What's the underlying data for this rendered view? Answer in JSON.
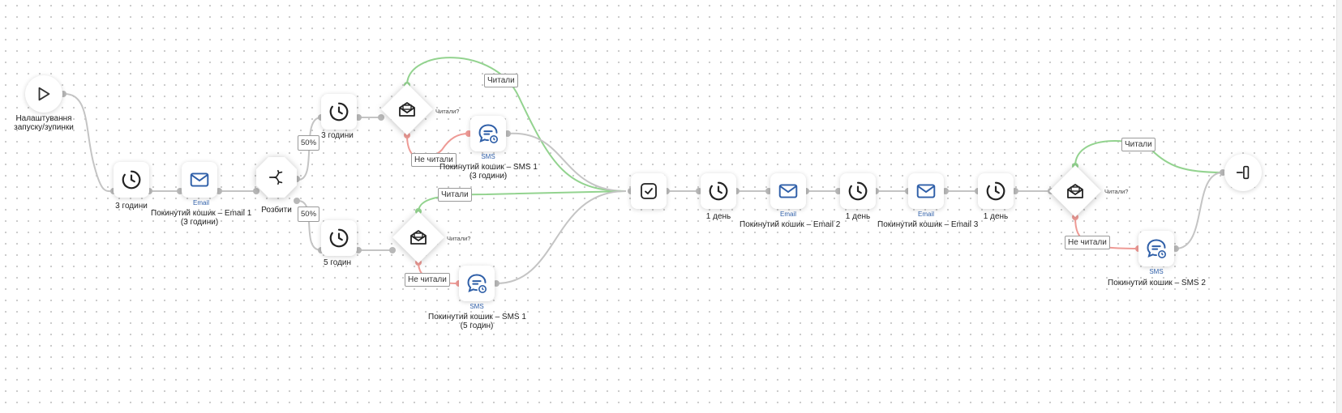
{
  "colors": {
    "edge": "#c4c4c4",
    "yes": "#93d38f",
    "no": "#ee9a95",
    "brand": "#2f5fa8"
  },
  "nodes": {
    "start": {
      "label_line1": "Налаштування",
      "label_line2": "запуску/зупинки",
      "icon": "play-icon"
    },
    "wait_1": {
      "label": "3 години",
      "icon": "clock-icon"
    },
    "email_1": {
      "sub": "Email",
      "label_line1": "Покинутий кошик – Email 1",
      "label_line2": "(3 години)",
      "icon": "mail-icon"
    },
    "split": {
      "label": "Розбити",
      "icon": "split-icon"
    },
    "wait_top": {
      "label": "3 години",
      "icon": "clock-icon"
    },
    "check_top": {
      "question": "Читали?",
      "icon": "mail-open-icon"
    },
    "sms_top": {
      "sub": "SMS",
      "label_line1": "Покинутий кошик – SMS 1",
      "label_line2": "(3 години)",
      "icon": "sms-icon"
    },
    "wait_bottom": {
      "label": "5 годин",
      "icon": "clock-icon"
    },
    "check_bottom": {
      "question": "Читали?",
      "icon": "mail-open-icon"
    },
    "sms_bottom": {
      "sub": "SMS",
      "label_line1": "Покинутий кошик – SMS 1",
      "label_line2": "(5 годин)",
      "icon": "sms-icon"
    },
    "merge": {
      "icon": "check-icon"
    },
    "wait_2": {
      "label": "1 день",
      "icon": "clock-icon"
    },
    "email_2": {
      "sub": "Email",
      "label": "Покинутий кошик – Email 2",
      "icon": "mail-icon"
    },
    "wait_3": {
      "label": "1 день",
      "icon": "clock-icon"
    },
    "email_3": {
      "sub": "Email",
      "label": "Покинутий кошик – Email 3",
      "icon": "mail-icon"
    },
    "wait_4": {
      "label": "1 день",
      "icon": "clock-icon"
    },
    "check_final": {
      "question": "Читали?",
      "icon": "mail-open-icon"
    },
    "sms_2": {
      "sub": "SMS",
      "label": "Покинутий кошик – SMS 2",
      "icon": "sms-icon"
    },
    "exit": {
      "icon": "exit-icon"
    }
  },
  "edge_labels": {
    "split_top": "50%",
    "split_bottom": "50%",
    "top_read": "Читали",
    "top_not_read": "Не читали",
    "bottom_read": "Читали",
    "bottom_not_read": "Не читали",
    "final_read": "Читали",
    "final_not_read": "Не читали"
  }
}
